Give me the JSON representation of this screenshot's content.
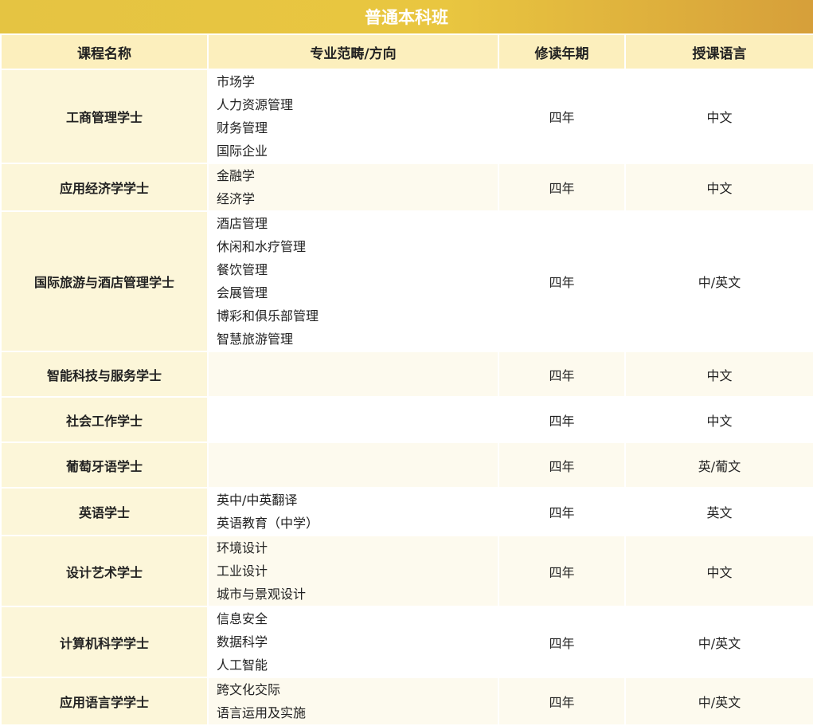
{
  "banner_title": "普通本科班",
  "headers": [
    "课程名称",
    "专业范畴/方向",
    "修读年期",
    "授课语言"
  ],
  "rows": [
    {
      "name": "工商管理学士",
      "specializations": [
        "市场学",
        "人力资源管理",
        "财务管理",
        "国际企业"
      ],
      "years": "四年",
      "language": "中文"
    },
    {
      "name": "应用经济学学士",
      "specializations": [
        "金融学",
        "经济学"
      ],
      "years": "四年",
      "language": "中文"
    },
    {
      "name": "国际旅游与酒店管理学士",
      "specializations": [
        "酒店管理",
        "休闲和水疗管理",
        "餐饮管理",
        "会展管理",
        "博彩和俱乐部管理",
        "智慧旅游管理"
      ],
      "years": "四年",
      "language": "中/英文"
    },
    {
      "name": "智能科技与服务学士",
      "specializations": [],
      "years": "四年",
      "language": "中文"
    },
    {
      "name": "社会工作学士",
      "specializations": [],
      "years": "四年",
      "language": "中文"
    },
    {
      "name": "葡萄牙语学士",
      "specializations": [],
      "years": "四年",
      "language": "英/葡文"
    },
    {
      "name": "英语学士",
      "specializations": [
        "英中/中英翻译",
        "英语教育（中学）"
      ],
      "years": "四年",
      "language": "英文"
    },
    {
      "name": "设计艺术学士",
      "specializations": [
        "环境设计",
        "工业设计",
        "城市与景观设计"
      ],
      "years": "四年",
      "language": "中文"
    },
    {
      "name": "计算机科学学士",
      "specializations": [
        "信息安全",
        "数据科学",
        "人工智能"
      ],
      "years": "四年",
      "language": "中/英文"
    },
    {
      "name": "应用语言学学士",
      "specializations": [
        "跨文化交际",
        "语言运用及实施"
      ],
      "years": "四年",
      "language": "中/英文"
    }
  ]
}
